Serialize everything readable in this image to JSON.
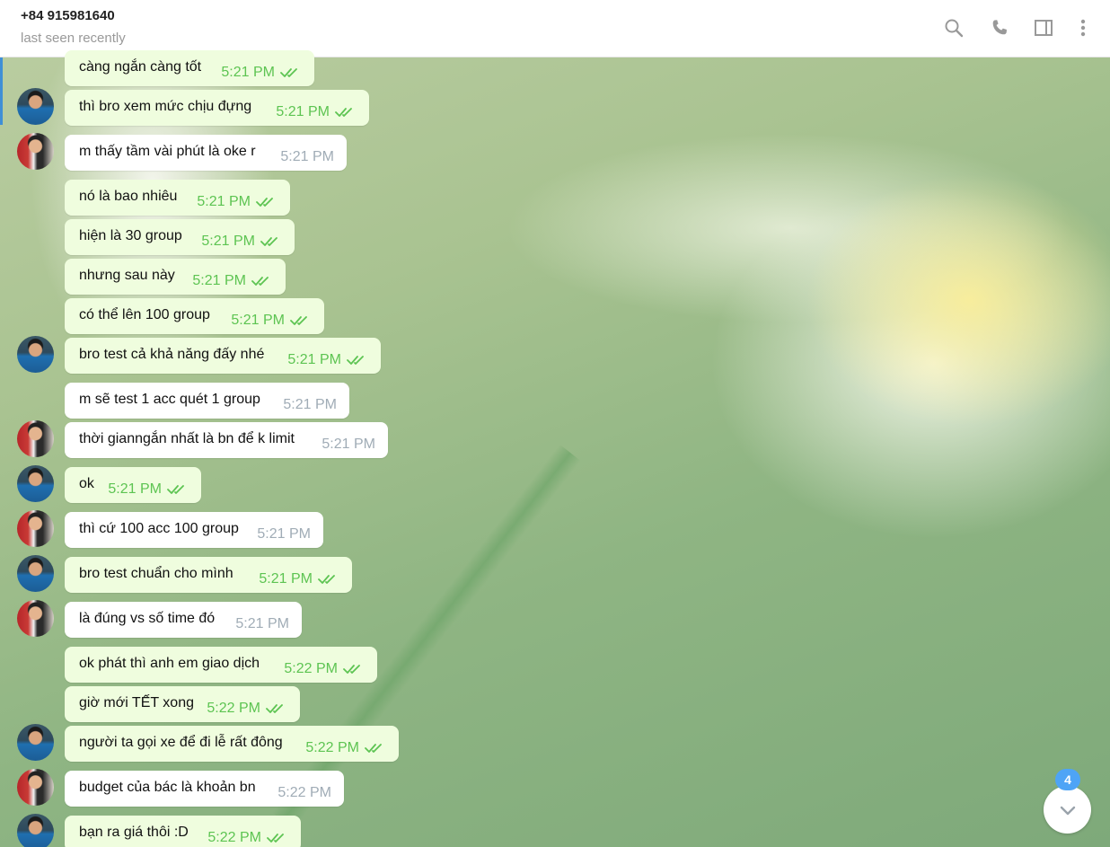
{
  "header": {
    "title": "+84 915981640",
    "status": "last seen recently"
  },
  "messages": [
    {
      "text": "càng ngắn càng tốt",
      "time": "5:21 PM",
      "dir": "out"
    },
    {
      "text": "thì bro xem mức chịu đựng",
      "time": "5:21 PM",
      "dir": "out"
    },
    {
      "text": "m thấy tầm vài phút là oke r",
      "time": "5:21 PM",
      "dir": "in"
    },
    {
      "text": "nó là bao nhiêu",
      "time": "5:21 PM",
      "dir": "out"
    },
    {
      "text": "hiện là 30 group",
      "time": "5:21 PM",
      "dir": "out"
    },
    {
      "text": "nhưng sau này",
      "time": "5:21 PM",
      "dir": "out"
    },
    {
      "text": "có thể lên 100 group",
      "time": "5:21 PM",
      "dir": "out"
    },
    {
      "text": "bro test cả khả năng đấy nhé",
      "time": "5:21 PM",
      "dir": "out"
    },
    {
      "text": "m sẽ test 1 acc quét 1 group",
      "time": "5:21 PM",
      "dir": "in"
    },
    {
      "text": "thời gianngắn nhất là bn để k limit",
      "time": "5:21 PM",
      "dir": "in"
    },
    {
      "text": "ok",
      "time": "5:21 PM",
      "dir": "out"
    },
    {
      "text": "thì cứ 100 acc 100 group",
      "time": "5:21 PM",
      "dir": "in"
    },
    {
      "text": "bro test chuẩn cho mình",
      "time": "5:21 PM",
      "dir": "out"
    },
    {
      "text": "là đúng vs số time đó",
      "time": "5:21 PM",
      "dir": "in"
    },
    {
      "text": "ok phát thì anh em giao dịch",
      "time": "5:22 PM",
      "dir": "out"
    },
    {
      "text": "giờ mới TẾT xong",
      "time": "5:22 PM",
      "dir": "out"
    },
    {
      "text": "người ta gọi xe để đi lễ rất đông",
      "time": "5:22 PM",
      "dir": "out"
    },
    {
      "text": "budget của bác là khoản bn",
      "time": "5:22 PM",
      "dir": "in"
    },
    {
      "text": "bạn ra giá thôi :D",
      "time": "5:22 PM",
      "dir": "out"
    }
  ],
  "scroll_down": {
    "unread_count": "4"
  },
  "icons": {
    "search": "search-icon",
    "call": "phone-icon",
    "sidebar": "sidebar-toggle-icon",
    "more": "more-vertical-icon",
    "scroll": "chevron-down-icon",
    "read": "double-check-icon"
  },
  "colors": {
    "outgoing_bubble": "#effdde",
    "incoming_bubble": "#ffffff",
    "outgoing_time": "#5dc452",
    "badge": "#4ea4f6"
  }
}
